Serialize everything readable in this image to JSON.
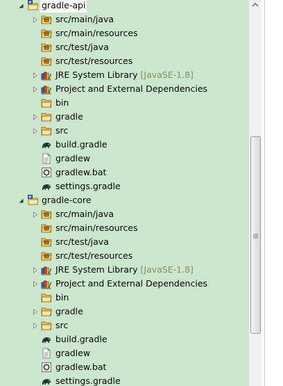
{
  "tree": {
    "projects": [
      {
        "name": "gradle-api",
        "selected": true,
        "children": [
          {
            "label": "src/main/java",
            "icon": "package-folder-icon",
            "expandable": true
          },
          {
            "label": "src/main/resources",
            "icon": "package-folder-icon",
            "expandable": false
          },
          {
            "label": "src/test/java",
            "icon": "package-folder-icon",
            "expandable": false
          },
          {
            "label": "src/test/resources",
            "icon": "package-folder-icon",
            "expandable": false
          },
          {
            "label": "JRE System Library",
            "decoration": "[JavaSE-1.8]",
            "icon": "library-icon",
            "expandable": true
          },
          {
            "label": "Project and External Dependencies",
            "icon": "library-icon",
            "expandable": true
          },
          {
            "label": "bin",
            "icon": "folder-icon",
            "expandable": false
          },
          {
            "label": "gradle",
            "icon": "folder-icon",
            "expandable": true
          },
          {
            "label": "src",
            "icon": "folder-icon",
            "expandable": true
          },
          {
            "label": "build.gradle",
            "icon": "gradle-elephant-icon",
            "expandable": false
          },
          {
            "label": "gradlew",
            "icon": "text-file-icon",
            "expandable": false
          },
          {
            "label": "gradlew.bat",
            "icon": "batch-file-icon",
            "expandable": false
          },
          {
            "label": "settings.gradle",
            "icon": "gradle-elephant-icon",
            "expandable": false
          }
        ]
      },
      {
        "name": "gradle-core",
        "selected": false,
        "children": [
          {
            "label": "src/main/java",
            "icon": "package-folder-icon",
            "expandable": true
          },
          {
            "label": "src/main/resources",
            "icon": "package-folder-icon",
            "expandable": false
          },
          {
            "label": "src/test/java",
            "icon": "package-folder-icon",
            "expandable": false
          },
          {
            "label": "src/test/resources",
            "icon": "package-folder-icon",
            "expandable": false
          },
          {
            "label": "JRE System Library",
            "decoration": "[JavaSE-1.8]",
            "icon": "library-icon",
            "expandable": true
          },
          {
            "label": "Project and External Dependencies",
            "icon": "library-icon",
            "expandable": true
          },
          {
            "label": "bin",
            "icon": "folder-icon",
            "expandable": false
          },
          {
            "label": "gradle",
            "icon": "folder-icon",
            "expandable": true
          },
          {
            "label": "src",
            "icon": "folder-icon",
            "expandable": true
          },
          {
            "label": "build.gradle",
            "icon": "gradle-elephant-icon",
            "expandable": false
          },
          {
            "label": "gradlew",
            "icon": "text-file-icon",
            "expandable": false
          },
          {
            "label": "gradlew.bat",
            "icon": "batch-file-icon",
            "expandable": false
          },
          {
            "label": "settings.gradle",
            "icon": "gradle-elephant-icon",
            "expandable": false
          }
        ]
      }
    ]
  },
  "scrollbar": {
    "position_fraction": 0.52,
    "visible_fraction": 0.51
  },
  "colors": {
    "tree_background": "#cbe8cf",
    "decoration_text": "#8e8b57",
    "selection_background": "#ffffff"
  }
}
